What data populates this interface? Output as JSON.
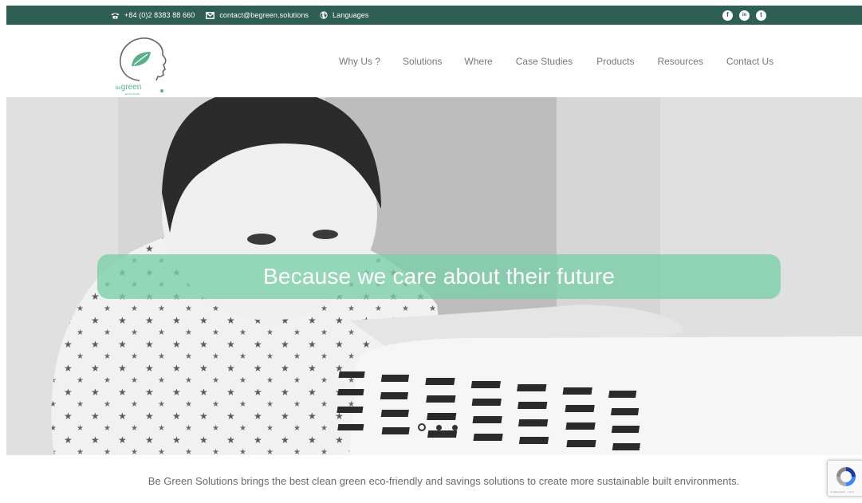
{
  "topbar": {
    "phone": "+84 (0)2 8383 88 660",
    "email": "contact@begreen.solutions",
    "languages": "Languages",
    "social": {
      "facebook": "f",
      "linkedin": "in",
      "twitter": "t"
    }
  },
  "logo": {
    "be": "be",
    "green": "green",
    "sub": "solutions"
  },
  "nav": {
    "items": [
      "Why Us ?",
      "Solutions",
      "Where",
      "Case Studies",
      "Products",
      "Resources",
      "Contact Us"
    ]
  },
  "hero": {
    "banner": "Because we care about their future",
    "slides": {
      "count": 3,
      "active": 1
    }
  },
  "tagline": "Be Green Solutions brings the best clean green eco-friendly and savings solutions to create more sustainable built environments.",
  "recaptcha": {
    "privacy": "Confidentialité - Condi"
  },
  "colors": {
    "topbar_bg": "#2f5e55",
    "accent_green": "#78cfa8",
    "logo_green": "#5bb08c",
    "nav_text": "#777777"
  },
  "icons": {
    "phone": "phone-icon",
    "email": "envelope-icon",
    "languages": "globe-icon",
    "facebook": "facebook-icon",
    "linkedin": "linkedin-icon",
    "twitter": "twitter-icon",
    "recaptcha": "recaptcha-icon"
  }
}
